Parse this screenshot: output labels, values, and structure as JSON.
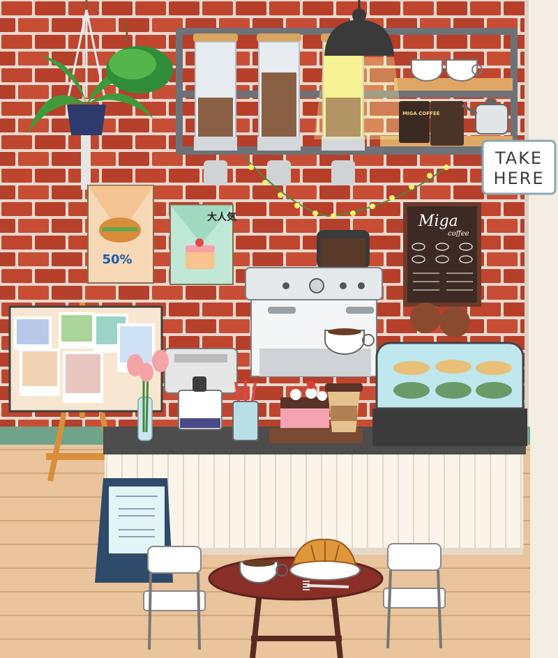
{
  "scene": {
    "name": "miga-cafe-counter",
    "colors": {
      "brick": "#c0452e",
      "mortar": "#e9d9cf",
      "floor": "#e8c29a",
      "counter_top": "#4d4d4d",
      "counter_front": "#fbf4ea",
      "table_top": "#8a2f27",
      "shelf_frame": "#6e7177"
    }
  },
  "sign": {
    "take_here": [
      "TAKE",
      "HERE"
    ]
  },
  "menu_board": {
    "brand": "Miga",
    "subtitle": "coffee"
  },
  "posters": {
    "sandwich_sale": "50%",
    "cake_jp": "大人気"
  },
  "coffee_bags": {
    "label": "MIGA COFFEE"
  },
  "items": [
    "hanging-plant",
    "coffee-bean-dispensers",
    "pendant-lamp",
    "string-lights",
    "espresso-machine",
    "cash-register",
    "pastry-display-case",
    "photo-board-easel",
    "sandwich-board-sign",
    "cafe-table",
    "croissant",
    "coffee-cup",
    "chairs"
  ]
}
